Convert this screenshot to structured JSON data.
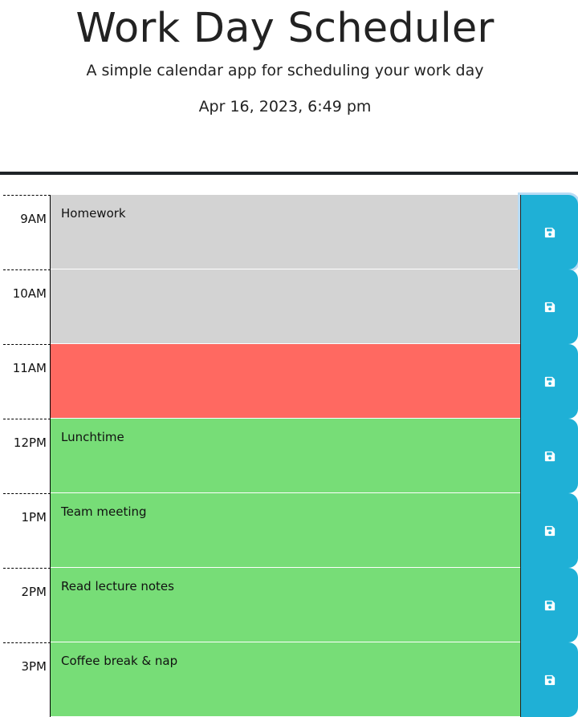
{
  "header": {
    "title": "Work Day Scheduler",
    "subtitle": "A simple calendar app for scheduling your work day",
    "datetime": "Apr 16, 2023, 6:49 pm"
  },
  "colors": {
    "past": "#d3d3d3",
    "present": "#ff6961",
    "future": "#77dd77",
    "save_button": "#1fb0d6"
  },
  "rows": [
    {
      "hour": "9AM",
      "text": "Homework",
      "state": "past",
      "save_icon": "floppy-disk-icon"
    },
    {
      "hour": "10AM",
      "text": "",
      "state": "past",
      "save_icon": "floppy-disk-icon"
    },
    {
      "hour": "11AM",
      "text": "",
      "state": "present",
      "save_icon": "floppy-disk-icon"
    },
    {
      "hour": "12PM",
      "text": "Lunchtime",
      "state": "future",
      "save_icon": "floppy-disk-icon"
    },
    {
      "hour": "1PM",
      "text": "Team meeting",
      "state": "future",
      "save_icon": "floppy-disk-icon"
    },
    {
      "hour": "2PM",
      "text": "Read lecture notes",
      "state": "future",
      "save_icon": "floppy-disk-icon"
    },
    {
      "hour": "3PM",
      "text": "Coffee break & nap",
      "state": "future",
      "save_icon": "floppy-disk-icon"
    }
  ]
}
